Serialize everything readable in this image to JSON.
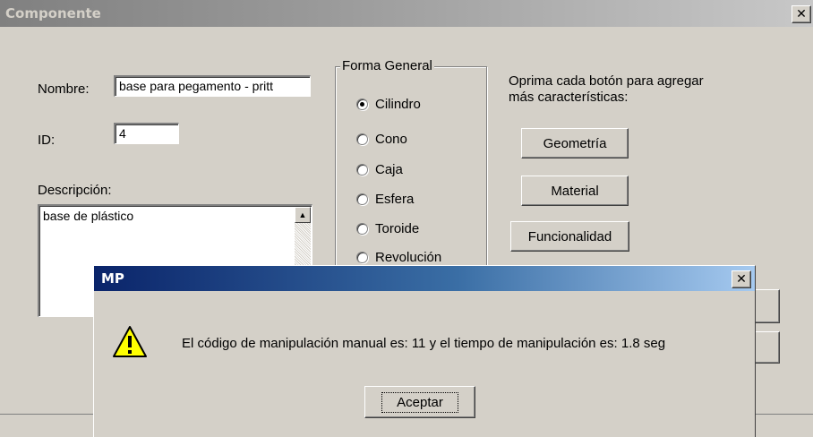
{
  "window": {
    "title": "Componente",
    "close_glyph": "✕"
  },
  "form": {
    "nombre_label": "Nombre:",
    "nombre_value": "base para pegamento - pritt",
    "id_label": "ID:",
    "id_value": "4",
    "descripcion_label": "Descripción:",
    "descripcion_value": "base de plástico"
  },
  "forma_general": {
    "caption": "Forma General",
    "options": [
      {
        "label": "Cilindro",
        "checked": true
      },
      {
        "label": "Cono",
        "checked": false
      },
      {
        "label": "Caja",
        "checked": false
      },
      {
        "label": "Esfera",
        "checked": false
      },
      {
        "label": "Toroide",
        "checked": false
      },
      {
        "label": "Revolución",
        "checked": false
      }
    ]
  },
  "instructions": {
    "line1": "Oprima cada botón para agregar",
    "line2": "más características:"
  },
  "buttons": {
    "geometria": "Geometría",
    "material": "Material",
    "funcionalidad": "Funcionalidad"
  },
  "dialog": {
    "title": "MP",
    "close_glyph": "✕",
    "icon": "warning-icon",
    "message": "El código de manipulación manual es: 11 y el tiempo de manipulación es: 1.8 seg",
    "ok_label": "Aceptar"
  },
  "colors": {
    "face": "#d4d0c8",
    "dialog_title_start": "#0a246a",
    "dialog_title_end": "#a6caf0",
    "warning_yellow": "#ffff00"
  }
}
